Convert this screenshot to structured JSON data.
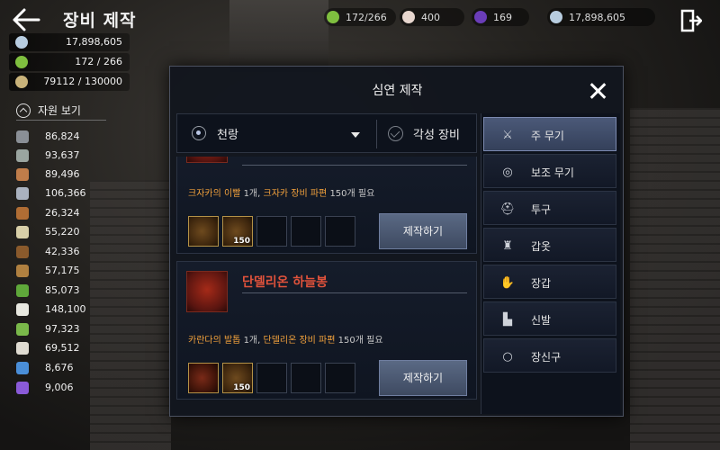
{
  "header": {
    "title": "장비 제작"
  },
  "top_currencies": [
    {
      "icon": "green-gem-icon",
      "value": "172/266",
      "color": "#7fbf3f"
    },
    {
      "icon": "pearl-icon",
      "value": "400",
      "color": "#e8d7cf"
    },
    {
      "icon": "purple-orb-icon",
      "value": "169",
      "color": "#6a3db8"
    },
    {
      "icon": "silver-coin-icon",
      "value": "17,898,605",
      "color": "#b8cde0"
    }
  ],
  "left_stats": [
    {
      "icon": "silver-coin-icon",
      "value": "17,898,605"
    },
    {
      "icon": "green-gem-icon",
      "value": "172 / 266"
    },
    {
      "icon": "wheat-icon",
      "value": "79112 / 130000"
    }
  ],
  "resources": {
    "toggle_label": "자원 보기",
    "items": [
      {
        "icon": "ore-icon",
        "value": "86,824",
        "color": "#8a8f96"
      },
      {
        "icon": "stone-icon",
        "value": "93,637",
        "color": "#9aa5a0"
      },
      {
        "icon": "leather-icon",
        "value": "89,496",
        "color": "#c07d4a"
      },
      {
        "icon": "feather-icon",
        "value": "106,366",
        "color": "#aab2bf"
      },
      {
        "icon": "wood-icon",
        "value": "26,324",
        "color": "#b06d34"
      },
      {
        "icon": "bone-icon",
        "value": "55,220",
        "color": "#d8cfa8"
      },
      {
        "icon": "log-icon",
        "value": "42,336",
        "color": "#8a5a2c"
      },
      {
        "icon": "root-icon",
        "value": "57,175",
        "color": "#b08040"
      },
      {
        "icon": "leaf-icon",
        "value": "85,073",
        "color": "#5fa83a"
      },
      {
        "icon": "flower-icon",
        "value": "148,100",
        "color": "#e8e8e0"
      },
      {
        "icon": "herb-icon",
        "value": "97,323",
        "color": "#7ab84a"
      },
      {
        "icon": "pearl-icon",
        "value": "69,512",
        "color": "#e0dcd2"
      },
      {
        "icon": "crystal-icon",
        "value": "8,676",
        "color": "#4a8ed8"
      },
      {
        "icon": "purple-orb-icon",
        "value": "9,006",
        "color": "#8a5ad8"
      }
    ]
  },
  "modal": {
    "title": "심연 제작",
    "filter": {
      "selected": "천랑",
      "checkbox_label": "각성 장비"
    },
    "recipes": [
      {
        "name": "",
        "requirement_prefix": "크자카의 이빨",
        "requirement_count": " 1개, ",
        "requirement_piece": "크자카 장비 파편",
        "requirement_suffix": " 150개 필요",
        "slot2_count": "150",
        "craft_label": "제작하기"
      },
      {
        "name": "단델리온 하늘봉",
        "requirement_prefix": "카란다의 발톱",
        "requirement_count": " 1개, ",
        "requirement_piece": "단델리온 장비 파편",
        "requirement_suffix": " 150개 필요",
        "slot2_count": "150",
        "craft_label": "제작하기"
      }
    ],
    "categories": [
      {
        "icon": "crossed-swords-icon",
        "label": "주 무기",
        "active": true
      },
      {
        "icon": "shield-icon",
        "label": "보조 무기",
        "active": false
      },
      {
        "icon": "helmet-icon",
        "label": "투구",
        "active": false
      },
      {
        "icon": "armor-icon",
        "label": "갑옷",
        "active": false
      },
      {
        "icon": "glove-icon",
        "label": "장갑",
        "active": false
      },
      {
        "icon": "boot-icon",
        "label": "신발",
        "active": false
      },
      {
        "icon": "ring-icon",
        "label": "장신구",
        "active": false
      }
    ]
  }
}
